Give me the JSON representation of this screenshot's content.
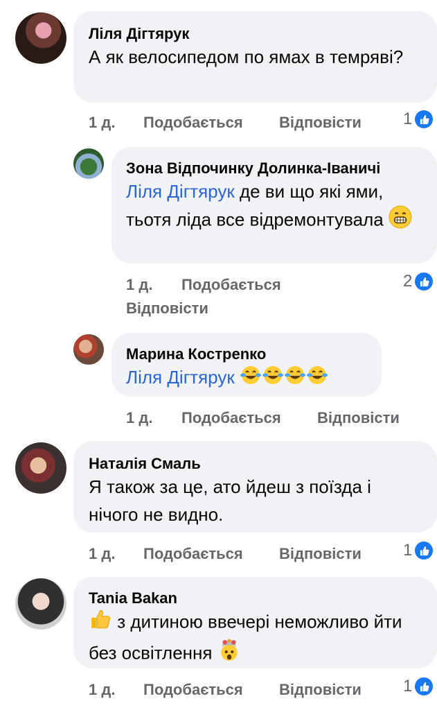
{
  "comments": [
    {
      "author": "Ліля Дігтярук",
      "text": "А як велосипедом по ямах в темряві?",
      "time": "1 д.",
      "like": "Подобається",
      "reply": "Відповісти",
      "reactions": "1"
    },
    {
      "author": "Зона Відпочинку Долинка-Іваничі",
      "mention": "Ліля Дігтярук",
      "text": "де ви що які ями, тьотя ліда все відремонтувала",
      "emojis": [
        "grinning-face"
      ],
      "time": "1 д.",
      "like": "Подобається",
      "reply": "Відповісти",
      "reactions": "2"
    },
    {
      "author": "Марина Кострenко",
      "mention": "Ліля Дігтярук",
      "emojis": [
        "tears-of-joy",
        "tears-of-joy",
        "tears-of-joy",
        "tears-of-joy"
      ],
      "time": "1 д.",
      "like": "Подобається",
      "reply": "Відповісти"
    },
    {
      "author": "Наталія Смаль",
      "text": "Я також за це, ато йдеш з поїзда і нічого не видно.",
      "time": "1 д.",
      "like": "Подобається",
      "reply": "Відповісти",
      "reactions": "1"
    },
    {
      "author": "Tania Bakan",
      "text": "з дитиною ввечері неможливо йти без освітлення",
      "emojis": [
        "thumbs-up",
        "exploding-head"
      ],
      "time": "1 д.",
      "like": "Подобається",
      "reply": "Відповісти",
      "reactions": "1"
    }
  ],
  "colors": {
    "bubble": "#f0f2f5",
    "mention": "#2a64d6",
    "meta": "#65676b",
    "like": "#1877f2"
  }
}
